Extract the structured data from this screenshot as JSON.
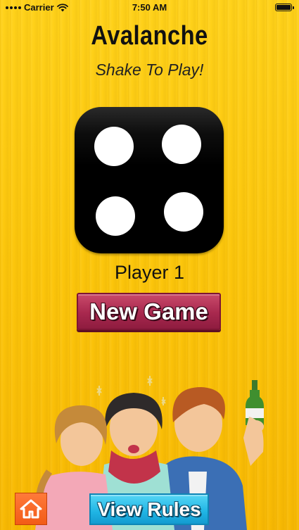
{
  "status_bar": {
    "carrier": "Carrier",
    "time": "7:50 AM",
    "icons": [
      "signal-icon",
      "wifi-icon",
      "battery-icon"
    ]
  },
  "header": {
    "title": "Avalanche",
    "subtitle": "Shake To Play!"
  },
  "die": {
    "face_value": 4,
    "icon": "die-face-icon"
  },
  "game": {
    "player_label": "Player 1",
    "new_game_label": "New Game"
  },
  "footer": {
    "home_icon": "home-icon",
    "view_rules_label": "View Rules"
  },
  "colors": {
    "background": "#fcc60b",
    "new_game_button": "#a8284e",
    "view_rules_button": "#1fb4e4",
    "home_button": "#f25b16",
    "die": "#000000"
  }
}
